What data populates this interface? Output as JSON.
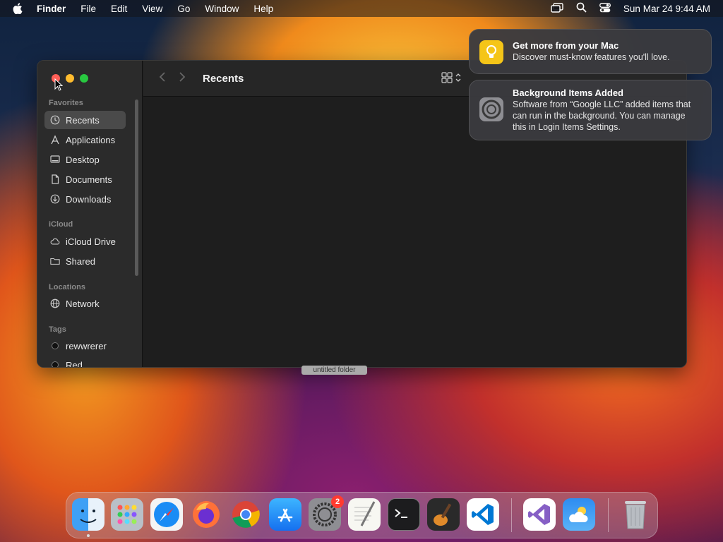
{
  "menubar": {
    "app_name": "Finder",
    "menus": [
      "File",
      "Edit",
      "View",
      "Go",
      "Window",
      "Help"
    ],
    "clock": "Sun Mar 24  9:44 AM"
  },
  "finder": {
    "title": "Recents",
    "sections": {
      "favorites": "Favorites",
      "icloud": "iCloud",
      "locations": "Locations",
      "tags": "Tags"
    },
    "favorites": [
      "Recents",
      "Applications",
      "Desktop",
      "Documents",
      "Downloads"
    ],
    "icloud": [
      "iCloud Drive",
      "Shared"
    ],
    "locations": [
      "Network"
    ],
    "tags": [
      "rewwrerer",
      "Red"
    ]
  },
  "desktop": {
    "folder_label": "untitled folder"
  },
  "notifications": [
    {
      "title": "Get more from your Mac",
      "body": "Discover must-know features you'll love."
    },
    {
      "title": "Background Items Added",
      "body": "Software from “Google LLC” added items that can run in the background. You can manage this in Login Items Settings."
    }
  ],
  "dock": {
    "apps": [
      "finder-icon",
      "launchpad-icon",
      "safari-icon",
      "firefox-icon",
      "chrome-icon",
      "app-store-icon",
      "system-settings-icon",
      "textedit-icon",
      "terminal-icon",
      "garageband-icon",
      "vscode-icon",
      "visual-studio-icon",
      "weather-icon",
      "trash-icon"
    ],
    "settings_badge": "2"
  }
}
